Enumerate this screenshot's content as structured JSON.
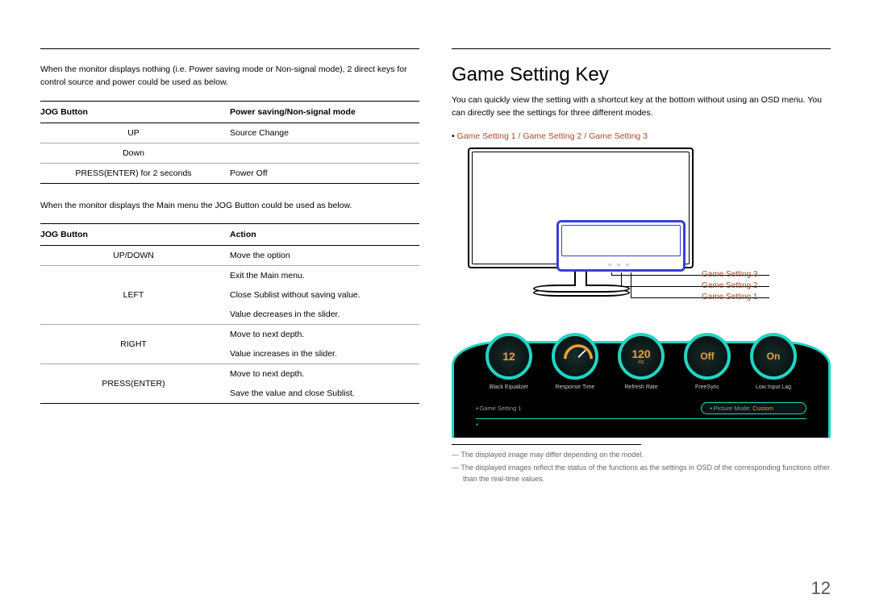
{
  "left": {
    "intro1": "When the monitor displays nothing (i.e. Power saving mode or Non-signal mode), 2 direct keys for control source and power could be used as below.",
    "t1": {
      "h1": "JOG Button",
      "h2": "Power saving/Non-signal mode",
      "rows": [
        {
          "a": "UP",
          "b": "Source Change"
        },
        {
          "a": "Down",
          "b": ""
        },
        {
          "a": "PRESS(ENTER) for 2 seconds",
          "b": "Power Off"
        }
      ]
    },
    "intro2": "When the monitor displays the Main menu the JOG Button could be used as below.",
    "t2": {
      "h1": "JOG Button",
      "h2": "Action",
      "rows": [
        {
          "a": "UP/DOWN",
          "b": "Move the option"
        },
        {
          "a": "LEFT",
          "b": "Exit the Main menu."
        },
        {
          "a": "",
          "b": "Close Sublist without saving value."
        },
        {
          "a": "",
          "b": "Value decreases in the slider."
        },
        {
          "a": "RIGHT",
          "b": "Move to next depth."
        },
        {
          "a": "",
          "b": "Value increases in the slider."
        },
        {
          "a": "PRESS(ENTER)",
          "b": "Move to next depth."
        },
        {
          "a": "",
          "b": "Save the value and close Sublist."
        }
      ]
    }
  },
  "right": {
    "title": "Game Setting Key",
    "desc": "You can quickly view the setting with a shortcut key at the bottom without using an OSD menu. You can directly see the settings for three different modes.",
    "bullet": {
      "g1": "Game Setting 1",
      "sep": " / ",
      "g2": "Game Setting 2",
      "g3": "Game Setting 3"
    },
    "callouts": {
      "c1": "Game Setting 3",
      "c2": "Game Setting 2",
      "c3": "Game Setting 1"
    },
    "gauges": [
      {
        "val": "12",
        "sub": "",
        "label": "Black Equalizer"
      },
      {
        "val": "",
        "sub": "",
        "label": "Response Time"
      },
      {
        "val": "120",
        "sub": "Hz",
        "label": "Refresh Rate"
      },
      {
        "val": "Off",
        "sub": "",
        "label": "FreeSync"
      },
      {
        "val": "On",
        "sub": "",
        "label": "Low Input Lag"
      }
    ],
    "osd_row2_left": "Game Setting 1",
    "osd_row2_pill_label": "Picture Mode: ",
    "osd_row2_pill_value": "Custom",
    "foot1": "The displayed image may differ depending on the model.",
    "foot2": "The displayed images reflect the status of the functions as the settings in OSD of the corresponding functions other than the real-time values."
  },
  "page_number": "12"
}
